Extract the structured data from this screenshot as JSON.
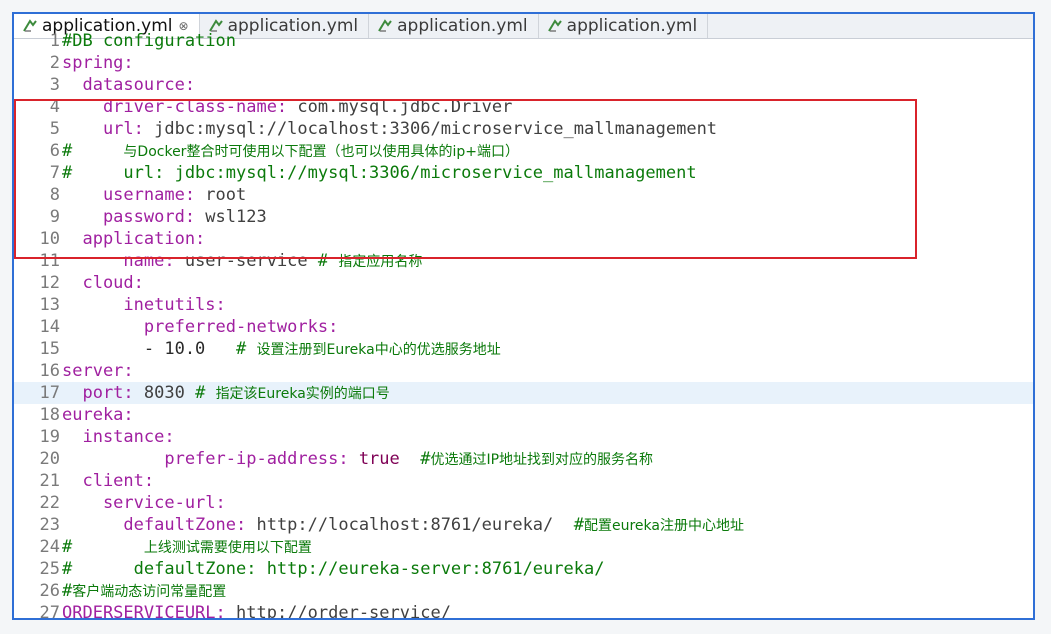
{
  "tabs": [
    {
      "label": "application.yml",
      "active": true,
      "close": "⊗"
    },
    {
      "label": "application.yml",
      "active": false
    },
    {
      "label": "application.yml",
      "active": false
    },
    {
      "label": "application.yml",
      "active": false
    }
  ],
  "lines": [
    {
      "n": "1",
      "parts": [
        {
          "t": "#DB configuration",
          "c": "cm"
        }
      ],
      "partial_top": true
    },
    {
      "n": "2",
      "parts": [
        {
          "t": "spring:",
          "c": "k1"
        }
      ]
    },
    {
      "n": "3",
      "parts": [
        {
          "t": "  datasource:",
          "c": "k1"
        }
      ]
    },
    {
      "n": "4",
      "parts": [
        {
          "t": "    driver-class-name: ",
          "c": "k1"
        },
        {
          "t": "com.mysql.jdbc.Driver",
          "c": "str"
        }
      ]
    },
    {
      "n": "5",
      "parts": [
        {
          "t": "    url: ",
          "c": "k1"
        },
        {
          "t": "jdbc:mysql://localhost:3306/microservice_mallmanagement",
          "c": "str"
        }
      ]
    },
    {
      "n": "6",
      "parts": [
        {
          "t": "#     ",
          "c": "cm"
        },
        {
          "t": "与Docker整合时可使用以下配置（也可以使用具体的ip+端口）",
          "c": "cmt"
        }
      ]
    },
    {
      "n": "7",
      "parts": [
        {
          "t": "#     url: jdbc:mysql://mysql:3306/microservice_mallmanagement",
          "c": "cm"
        }
      ]
    },
    {
      "n": "8",
      "parts": [
        {
          "t": "    username: ",
          "c": "k1"
        },
        {
          "t": "root",
          "c": "str"
        }
      ]
    },
    {
      "n": "9",
      "parts": [
        {
          "t": "    password: ",
          "c": "k1"
        },
        {
          "t": "wsl123",
          "c": "str"
        }
      ]
    },
    {
      "n": "10",
      "parts": [
        {
          "t": "  application:",
          "c": "k1"
        }
      ]
    },
    {
      "n": "11",
      "parts": [
        {
          "t": "      name: ",
          "c": "k1"
        },
        {
          "t": "user-service ",
          "c": "str"
        },
        {
          "t": "# ",
          "c": "cm"
        },
        {
          "t": "指定应用名称",
          "c": "cmt"
        }
      ]
    },
    {
      "n": "12",
      "parts": [
        {
          "t": "  cloud:",
          "c": "k1"
        }
      ]
    },
    {
      "n": "13",
      "parts": [
        {
          "t": "      inetutils:",
          "c": "k1"
        }
      ]
    },
    {
      "n": "14",
      "parts": [
        {
          "t": "        preferred-networks:",
          "c": "k1"
        }
      ]
    },
    {
      "n": "15",
      "parts": [
        {
          "t": "        - 10.0   ",
          "c": "v"
        },
        {
          "t": "# ",
          "c": "cm"
        },
        {
          "t": "设置注册到Eureka中心的优选服务地址",
          "c": "cmt"
        }
      ]
    },
    {
      "n": "16",
      "parts": [
        {
          "t": "server:",
          "c": "k1"
        }
      ]
    },
    {
      "n": "17",
      "parts": [
        {
          "t": "  port: ",
          "c": "k1"
        },
        {
          "t": "8030 ",
          "c": "str"
        },
        {
          "t": "# ",
          "c": "cm"
        },
        {
          "t": "指定该Eureka实例的端口号",
          "c": "cmt"
        }
      ],
      "current": true
    },
    {
      "n": "18",
      "parts": [
        {
          "t": "eureka:",
          "c": "k1"
        }
      ]
    },
    {
      "n": "19",
      "parts": [
        {
          "t": "  instance:",
          "c": "k1"
        }
      ]
    },
    {
      "n": "20",
      "parts": [
        {
          "t": "          prefer-ip-address: ",
          "c": "k1"
        },
        {
          "t": "true  ",
          "c": "k"
        },
        {
          "t": "#",
          "c": "cm"
        },
        {
          "t": "优选通过IP地址找到对应的服务名称",
          "c": "cmt"
        }
      ]
    },
    {
      "n": "21",
      "parts": [
        {
          "t": "  client:",
          "c": "k1"
        }
      ]
    },
    {
      "n": "22",
      "parts": [
        {
          "t": "    service-url:",
          "c": "k1"
        }
      ]
    },
    {
      "n": "23",
      "parts": [
        {
          "t": "      defaultZone: ",
          "c": "k1"
        },
        {
          "t": "http://localhost:8761/eureka/  ",
          "c": "str"
        },
        {
          "t": "#",
          "c": "cm"
        },
        {
          "t": "配置eureka注册中心地址",
          "c": "cmt"
        }
      ]
    },
    {
      "n": "24",
      "parts": [
        {
          "t": "#       ",
          "c": "cm"
        },
        {
          "t": "上线测试需要使用以下配置",
          "c": "cmt"
        }
      ]
    },
    {
      "n": "25",
      "parts": [
        {
          "t": "#      defaultZone: http://eureka-server:8761/eureka/",
          "c": "cm"
        }
      ]
    },
    {
      "n": "26",
      "parts": [
        {
          "t": "#",
          "c": "cm"
        },
        {
          "t": "客户端动态访问常量配置",
          "c": "cmt"
        }
      ]
    },
    {
      "n": "27",
      "parts": [
        {
          "t": "ORDERSERVICEURL: ",
          "c": "k1"
        },
        {
          "t": "http://order-service/",
          "c": "str"
        }
      ],
      "partial_bottom": true
    }
  ]
}
